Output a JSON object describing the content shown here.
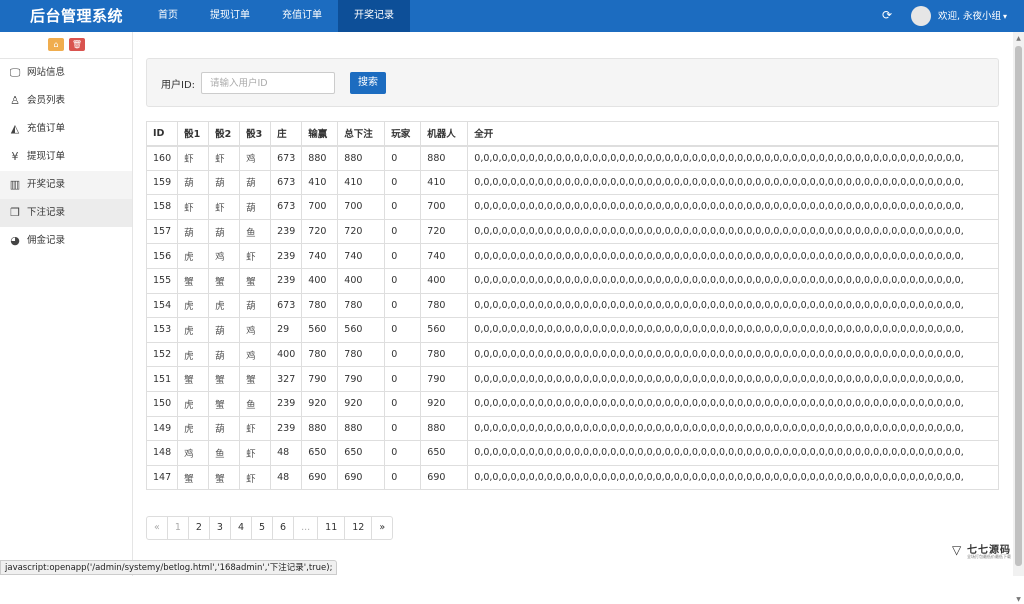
{
  "app": {
    "title": "后台管理系统"
  },
  "topnav": [
    "首页",
    "提现订单",
    "充值订单",
    "开奖记录"
  ],
  "user": {
    "greeting": "欢迎, 永夜小组",
    "caret": "▾"
  },
  "icons": {
    "refresh": "refresh-icon",
    "home": "home-icon",
    "trash": "trash-icon"
  },
  "colors": {
    "topbar": "#1c6cc0",
    "active_nav": "#0d4f98",
    "primary_button": "#1c6cc0",
    "home_button": "#f0ad4e",
    "trash_button": "#d9534f"
  },
  "sidebar": [
    {
      "label": "网站信息",
      "icon": "monitor-icon",
      "glyph": "🖵"
    },
    {
      "label": "会员列表",
      "icon": "user-icon",
      "glyph": "♙"
    },
    {
      "label": "充值订单",
      "icon": "area-chart-icon",
      "glyph": "◭"
    },
    {
      "label": "提现订单",
      "icon": "yen-icon",
      "glyph": "¥"
    },
    {
      "label": "开奖记录",
      "icon": "bar-chart-icon",
      "glyph": "▥"
    },
    {
      "label": "下注记录",
      "icon": "windows-icon",
      "glyph": "❐"
    },
    {
      "label": "佣金记录",
      "icon": "pie-chart-icon",
      "glyph": "◕"
    }
  ],
  "search": {
    "label": "用户ID:",
    "placeholder": "请输入用户ID",
    "value": "",
    "button": "搜索"
  },
  "table": {
    "headers": [
      "ID",
      "骰1",
      "骰2",
      "骰3",
      "庄",
      "输赢",
      "总下注",
      "玩家",
      "机器人",
      "全开"
    ],
    "rows": [
      [
        "160",
        "虾",
        "虾",
        "鸡",
        "673",
        "880",
        "880",
        "0",
        "880",
        "0,0,0,0,0,0,0,0,0,0,0,0,0,0,0,0,0,0,0,0,0,0,0,0,0,0,0,0,0,0,0,0,0,0,0,0,0,0,0,0,0,0,0,0,0,0,0,0,0,0,0,0,0,0,"
      ],
      [
        "159",
        "葫",
        "葫",
        "葫",
        "673",
        "410",
        "410",
        "0",
        "410",
        "0,0,0,0,0,0,0,0,0,0,0,0,0,0,0,0,0,0,0,0,0,0,0,0,0,0,0,0,0,0,0,0,0,0,0,0,0,0,0,0,0,0,0,0,0,0,0,0,0,0,0,0,0,0,"
      ],
      [
        "158",
        "虾",
        "虾",
        "葫",
        "673",
        "700",
        "700",
        "0",
        "700",
        "0,0,0,0,0,0,0,0,0,0,0,0,0,0,0,0,0,0,0,0,0,0,0,0,0,0,0,0,0,0,0,0,0,0,0,0,0,0,0,0,0,0,0,0,0,0,0,0,0,0,0,0,0,0,"
      ],
      [
        "157",
        "葫",
        "葫",
        "鱼",
        "239",
        "720",
        "720",
        "0",
        "720",
        "0,0,0,0,0,0,0,0,0,0,0,0,0,0,0,0,0,0,0,0,0,0,0,0,0,0,0,0,0,0,0,0,0,0,0,0,0,0,0,0,0,0,0,0,0,0,0,0,0,0,0,0,0,0,"
      ],
      [
        "156",
        "虎",
        "鸡",
        "虾",
        "239",
        "740",
        "740",
        "0",
        "740",
        "0,0,0,0,0,0,0,0,0,0,0,0,0,0,0,0,0,0,0,0,0,0,0,0,0,0,0,0,0,0,0,0,0,0,0,0,0,0,0,0,0,0,0,0,0,0,0,0,0,0,0,0,0,0,"
      ],
      [
        "155",
        "蟹",
        "蟹",
        "蟹",
        "239",
        "400",
        "400",
        "0",
        "400",
        "0,0,0,0,0,0,0,0,0,0,0,0,0,0,0,0,0,0,0,0,0,0,0,0,0,0,0,0,0,0,0,0,0,0,0,0,0,0,0,0,0,0,0,0,0,0,0,0,0,0,0,0,0,0,"
      ],
      [
        "154",
        "虎",
        "虎",
        "葫",
        "673",
        "780",
        "780",
        "0",
        "780",
        "0,0,0,0,0,0,0,0,0,0,0,0,0,0,0,0,0,0,0,0,0,0,0,0,0,0,0,0,0,0,0,0,0,0,0,0,0,0,0,0,0,0,0,0,0,0,0,0,0,0,0,0,0,0,"
      ],
      [
        "153",
        "虎",
        "葫",
        "鸡",
        "29",
        "560",
        "560",
        "0",
        "560",
        "0,0,0,0,0,0,0,0,0,0,0,0,0,0,0,0,0,0,0,0,0,0,0,0,0,0,0,0,0,0,0,0,0,0,0,0,0,0,0,0,0,0,0,0,0,0,0,0,0,0,0,0,0,0,"
      ],
      [
        "152",
        "虎",
        "葫",
        "鸡",
        "400",
        "780",
        "780",
        "0",
        "780",
        "0,0,0,0,0,0,0,0,0,0,0,0,0,0,0,0,0,0,0,0,0,0,0,0,0,0,0,0,0,0,0,0,0,0,0,0,0,0,0,0,0,0,0,0,0,0,0,0,0,0,0,0,0,0,"
      ],
      [
        "151",
        "蟹",
        "蟹",
        "蟹",
        "327",
        "790",
        "790",
        "0",
        "790",
        "0,0,0,0,0,0,0,0,0,0,0,0,0,0,0,0,0,0,0,0,0,0,0,0,0,0,0,0,0,0,0,0,0,0,0,0,0,0,0,0,0,0,0,0,0,0,0,0,0,0,0,0,0,0,"
      ],
      [
        "150",
        "虎",
        "蟹",
        "鱼",
        "239",
        "920",
        "920",
        "0",
        "920",
        "0,0,0,0,0,0,0,0,0,0,0,0,0,0,0,0,0,0,0,0,0,0,0,0,0,0,0,0,0,0,0,0,0,0,0,0,0,0,0,0,0,0,0,0,0,0,0,0,0,0,0,0,0,0,"
      ],
      [
        "149",
        "虎",
        "葫",
        "虾",
        "239",
        "880",
        "880",
        "0",
        "880",
        "0,0,0,0,0,0,0,0,0,0,0,0,0,0,0,0,0,0,0,0,0,0,0,0,0,0,0,0,0,0,0,0,0,0,0,0,0,0,0,0,0,0,0,0,0,0,0,0,0,0,0,0,0,0,"
      ],
      [
        "148",
        "鸡",
        "鱼",
        "虾",
        "48",
        "650",
        "650",
        "0",
        "650",
        "0,0,0,0,0,0,0,0,0,0,0,0,0,0,0,0,0,0,0,0,0,0,0,0,0,0,0,0,0,0,0,0,0,0,0,0,0,0,0,0,0,0,0,0,0,0,0,0,0,0,0,0,0,0,"
      ],
      [
        "147",
        "蟹",
        "蟹",
        "虾",
        "48",
        "690",
        "690",
        "0",
        "690",
        "0,0,0,0,0,0,0,0,0,0,0,0,0,0,0,0,0,0,0,0,0,0,0,0,0,0,0,0,0,0,0,0,0,0,0,0,0,0,0,0,0,0,0,0,0,0,0,0,0,0,0,0,0,0,"
      ]
    ]
  },
  "pagination": [
    "«",
    "1",
    "2",
    "3",
    "4",
    "5",
    "6",
    "...",
    "11",
    "12",
    "»"
  ],
  "status_bar": "javascript:openapp('/admin/systemy/betlog.html','168admin','下注记录',true);",
  "watermark": {
    "name": "七七源码",
    "sub": "全场打包最低价最低下载"
  }
}
